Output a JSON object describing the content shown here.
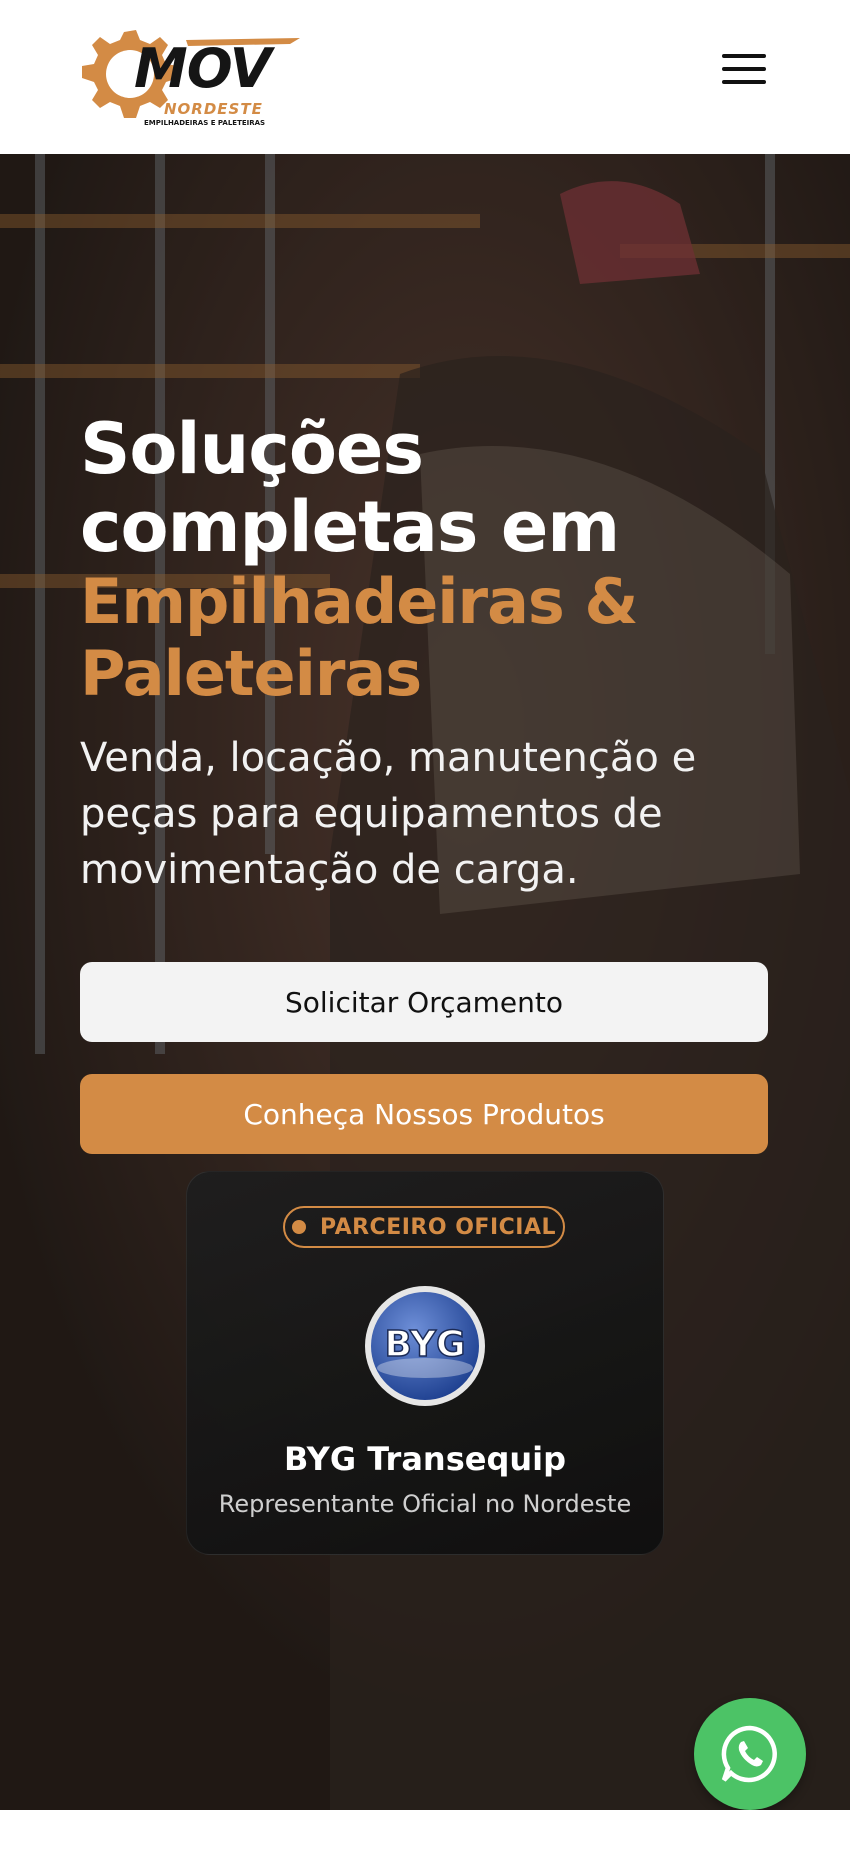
{
  "header": {
    "logo": {
      "main_text": "MOV",
      "secondary_text": "NORDESTE",
      "tagline": "EMPILHADEIRAS E PALETEIRAS"
    },
    "menu_icon": "hamburger-menu-icon"
  },
  "hero": {
    "title_line_1": "Soluções",
    "title_line_2": "completas em",
    "title_accent_line_1": "Empilhadeiras &",
    "title_accent_line_2": "Paleteiras",
    "subtitle": "Venda, locação, manutenção e peças para equipamentos de movimentação de carga.",
    "primary_button": "Solicitar Orçamento",
    "secondary_button": "Conheça Nossos Produtos"
  },
  "partner": {
    "badge": "PARCEIRO OFICIAL",
    "logo_text": "BYG",
    "name": "BYG Transequip",
    "description": "Representante Oficial no Nordeste"
  },
  "floating": {
    "whatsapp_icon": "whatsapp-icon"
  },
  "colors": {
    "accent": "#d38b45",
    "whatsapp": "#4cc366",
    "header_bg": "#ffffff"
  }
}
